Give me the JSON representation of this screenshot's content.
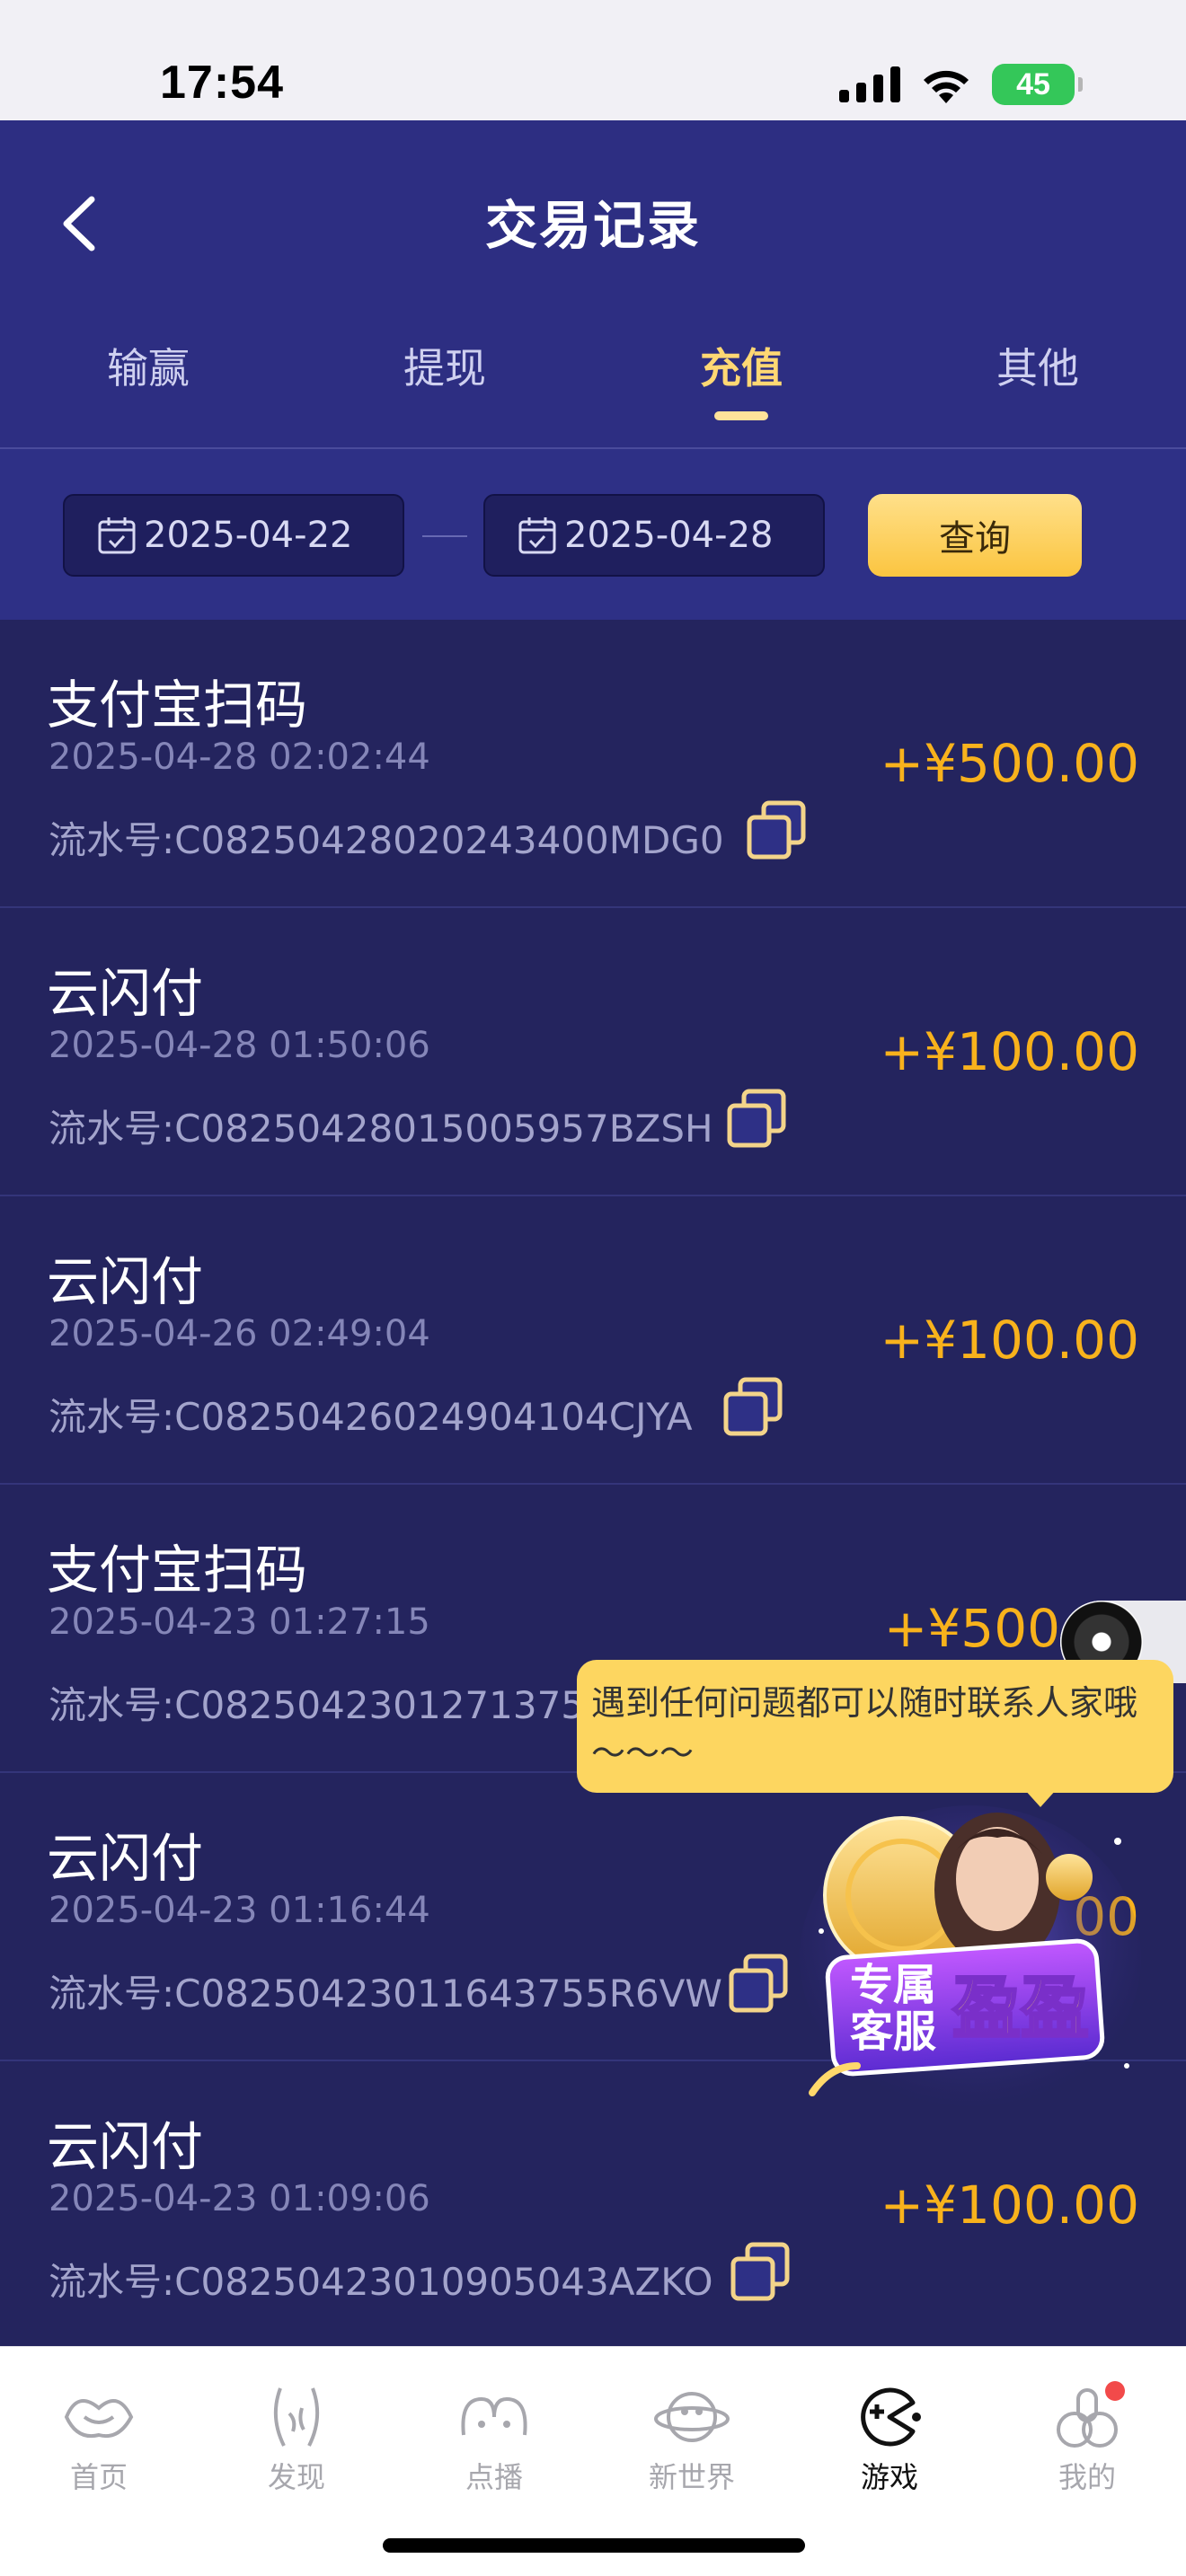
{
  "status_bar": {
    "time": "17:54",
    "battery": "45"
  },
  "header": {
    "title": "交易记录"
  },
  "tabs": [
    {
      "label": "输赢",
      "active": false
    },
    {
      "label": "提现",
      "active": false
    },
    {
      "label": "充值",
      "active": true
    },
    {
      "label": "其他",
      "active": false
    }
  ],
  "filter": {
    "start_date": "2025-04-22",
    "end_date": "2025-04-28",
    "query_label": "查询"
  },
  "records": [
    {
      "method": "支付宝扫码",
      "time": "2025-04-28 02:02:44",
      "serial": "流水号:C08250428020243400MDG0",
      "amount": "+¥500.00"
    },
    {
      "method": "云闪付",
      "time": "2025-04-28 01:50:06",
      "serial": "流水号:C08250428015005957BZSH",
      "amount": "+¥100.00"
    },
    {
      "method": "云闪付",
      "time": "2025-04-26 02:49:04",
      "serial": "流水号:C08250426024904104CJYA",
      "amount": "+¥100.00"
    },
    {
      "method": "支付宝扫码",
      "time": "2025-04-23 01:27:15",
      "serial": "流水号:C08250423012713754",
      "amount": "+¥500"
    },
    {
      "method": "云闪付",
      "time": "2025-04-23 01:16:44",
      "serial": "流水号:C08250423011643755R6VW",
      "amount": "00"
    },
    {
      "method": "云闪付",
      "time": "2025-04-23 01:09:06",
      "serial": "流水号:C08250423010905043AZKO",
      "amount": "+¥100.00"
    }
  ],
  "tooltip": {
    "text": "遇到任何问题都可以随时联系人家哦～～～"
  },
  "service_badge": {
    "line1": "专属",
    "line2": "客服",
    "name": "盈盈"
  },
  "bottom_nav": [
    {
      "label": "首页",
      "icon": "home-icon",
      "active": false
    },
    {
      "label": "发现",
      "icon": "discover-icon",
      "active": false
    },
    {
      "label": "点播",
      "icon": "vod-icon",
      "active": false
    },
    {
      "label": "新世界",
      "icon": "new-world-icon",
      "active": false
    },
    {
      "label": "游戏",
      "icon": "game-icon",
      "active": true
    },
    {
      "label": "我的",
      "icon": "profile-icon",
      "active": false
    }
  ],
  "colors": {
    "header_bg": "#2d2e82",
    "list_bg": "#24245e",
    "accent_gold": "#f8b21c",
    "tab_active": "#ffd873"
  }
}
